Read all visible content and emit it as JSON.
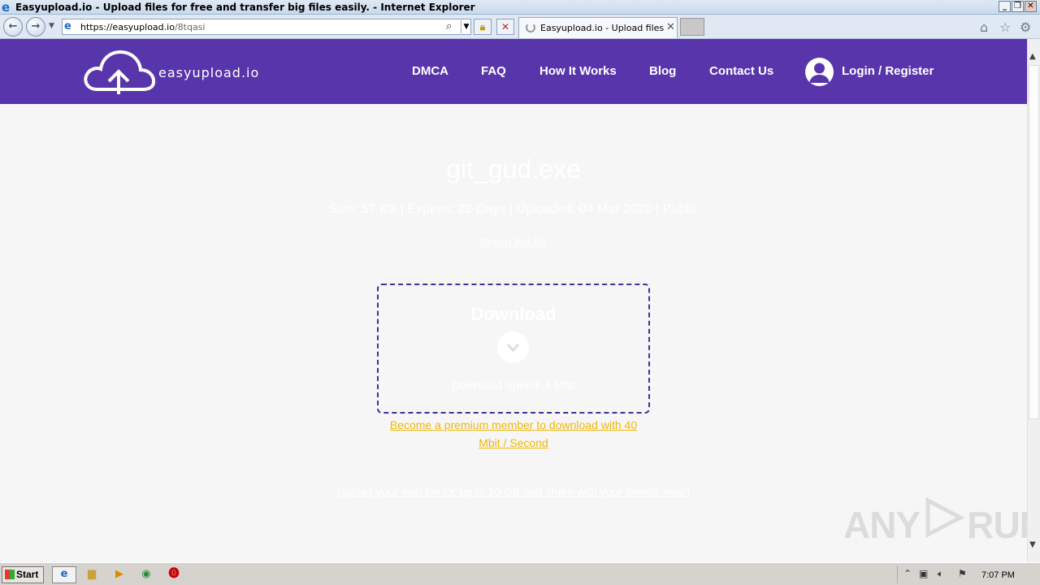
{
  "window": {
    "title": "Easyupload.io - Upload files for free and transfer big files easily. - Internet Explorer",
    "controls": {
      "minimize": "_",
      "restore": "❐",
      "close": "✕"
    }
  },
  "browser": {
    "url_host": "https://easyupload.io",
    "url_path": "/8tqasi",
    "tab_label": "Easyupload.io - Upload files f...",
    "icons": [
      "back-icon",
      "forward-icon",
      "search-icon",
      "lock-icon",
      "stop-icon",
      "home-icon",
      "star-icon",
      "gear-icon"
    ]
  },
  "site": {
    "logo_text": "easyupload.io",
    "nav": {
      "dmca": "DMCA",
      "faq": "FAQ",
      "how": "How It Works",
      "blog": "Blog",
      "contact": "Contact Us",
      "login": "Login / Register"
    },
    "colors": {
      "header": "#5935ac",
      "accent": "#f2b705",
      "dash": "#4b2a99"
    }
  },
  "file": {
    "name": "git_gud.exe",
    "meta": "Size: 57 KB | Expires: 22 Days | Uploaded: 04 Mar 2020 | Public",
    "report": "Report this file",
    "download_title": "Download",
    "download_speed": "Download Speed: 4 Mbit",
    "premium_line1": "Become a premium member to download with 40",
    "premium_line2": "Mbit / Second",
    "upload_own": "Upload your own file for up to 10 GB and share with your friends now !"
  },
  "watermark": {
    "left": "ANY",
    "right": "RUN"
  },
  "taskbar": {
    "start": "Start",
    "clock": "7:07 PM"
  }
}
